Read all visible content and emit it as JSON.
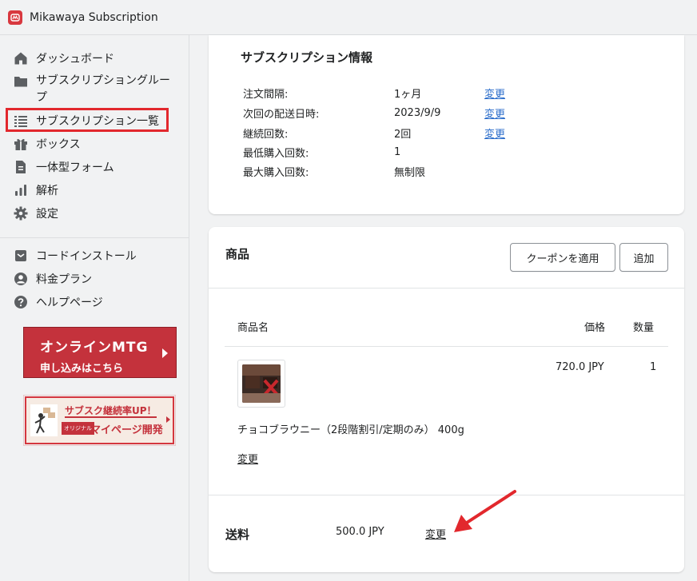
{
  "app": {
    "title": "Mikawaya Subscription"
  },
  "sidebar": {
    "items": [
      {
        "label": "ダッシュボード",
        "icon": "home-icon"
      },
      {
        "label": "サブスクリプショングループ",
        "icon": "folder-icon"
      },
      {
        "label": "サブスクリプション一覧",
        "icon": "list-icon"
      },
      {
        "label": "ボックス",
        "icon": "gift-icon"
      },
      {
        "label": "一体型フォーム",
        "icon": "document-icon"
      },
      {
        "label": "解析",
        "icon": "analytics-icon"
      },
      {
        "label": "設定",
        "icon": "gear-icon"
      }
    ],
    "secondary": [
      {
        "label": "コードインストール",
        "icon": "code-icon"
      },
      {
        "label": "料金プラン",
        "icon": "person-icon"
      },
      {
        "label": "ヘルプページ",
        "icon": "help-icon"
      }
    ],
    "banner_mtg": {
      "title": "オンラインMTG",
      "sub": "申し込みはこちら"
    },
    "banner_mypage": {
      "line1": "サブスク継続率UP！",
      "chip": "オリジナル",
      "line2": "マイページ開発"
    }
  },
  "subscription_info": {
    "title": "サブスクリプション情報",
    "rows": [
      {
        "label": "注文間隔:",
        "value": "1ヶ月",
        "action": "変更"
      },
      {
        "label": "次回の配送日時:",
        "value": "2023/9/9",
        "action": "変更"
      },
      {
        "label": "継続回数:",
        "value": "2回",
        "action": "変更"
      },
      {
        "label": "最低購入回数:",
        "value": "1",
        "action": ""
      },
      {
        "label": "最大購入回数:",
        "value": "無制限",
        "action": ""
      }
    ]
  },
  "products": {
    "title": "商品",
    "coupon_button": "クーポンを適用",
    "add_button": "追加",
    "columns": {
      "name": "商品名",
      "price": "価格",
      "quantity": "数量"
    },
    "items": [
      {
        "name": "チョコブラウニー（2段階割引/定期のみ） 400g",
        "price": "720.0 JPY",
        "quantity": "1",
        "action": "変更"
      }
    ]
  },
  "shipping": {
    "label": "送料",
    "value": "500.0 JPY",
    "action": "変更"
  },
  "colors": {
    "accent": "#e2282d",
    "link": "#2c6ecb",
    "brand": "#c4323c"
  }
}
